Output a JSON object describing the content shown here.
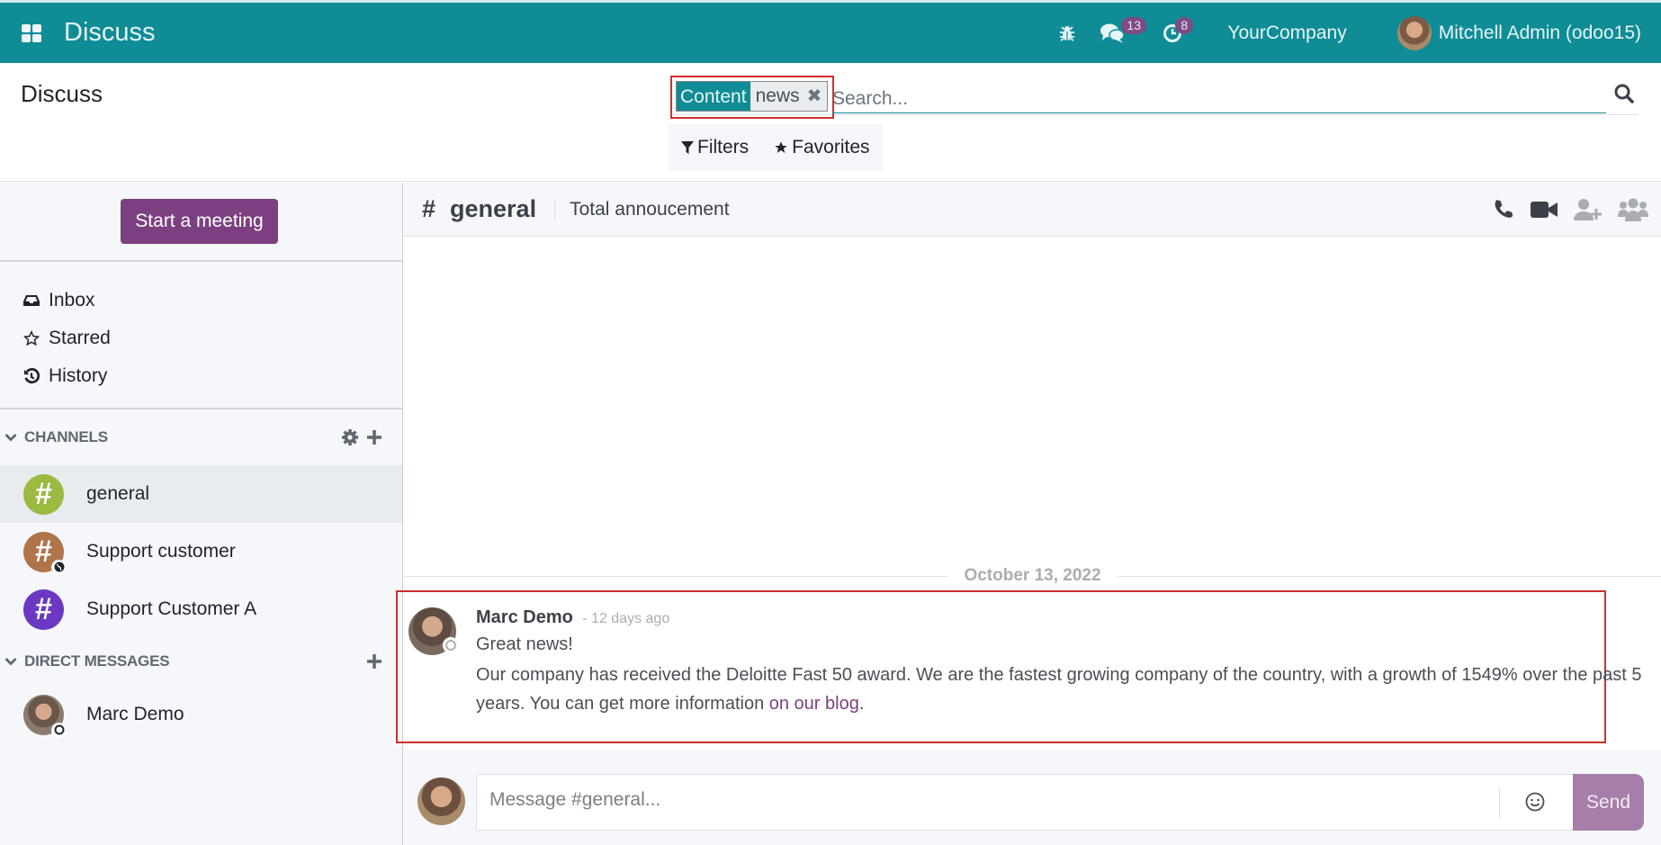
{
  "navbar": {
    "app_title": "Discuss",
    "messages_badge": "13",
    "activities_badge": "8",
    "company": "YourCompany",
    "user": "Mitchell Admin (odoo15)"
  },
  "control_panel": {
    "title": "Discuss",
    "search": {
      "facet_label": "Content",
      "facet_value": "news",
      "placeholder": "Search..."
    },
    "filters_label": "Filters",
    "favorites_label": "Favorites"
  },
  "sidebar": {
    "start_meeting": "Start a meeting",
    "mailboxes": [
      {
        "label": "Inbox",
        "icon": "inbox-icon"
      },
      {
        "label": "Starred",
        "icon": "star-icon"
      },
      {
        "label": "History",
        "icon": "history-icon"
      }
    ],
    "channels_header": "CHANNELS",
    "channels": [
      {
        "name": "general",
        "color": "#9aba42",
        "active": true
      },
      {
        "name": "Support customer",
        "color": "#b0744a",
        "public": true
      },
      {
        "name": "Support Customer A",
        "color": "#6a38c2"
      }
    ],
    "dm_header": "DIRECT MESSAGES",
    "direct_messages": [
      {
        "name": "Marc Demo"
      }
    ]
  },
  "thread": {
    "hash": "#",
    "name": "general",
    "description": "Total annoucement",
    "date_separator": "October 13, 2022",
    "message": {
      "author": "Marc Demo",
      "date": "- 12 days ago",
      "line1": "Great news!",
      "line2": "Our company has received the Deloitte Fast 50 award. We are the fastest growing company of the country, with a growth of 1549% over the past 5 years. You can get more information ",
      "link": "on our blog",
      "line_end": "."
    },
    "composer": {
      "placeholder": "Message #general...",
      "send": "Send"
    }
  },
  "colors": {
    "navbar": "#0f8c96",
    "primary": "#7c4080",
    "highlight_outline": "#cc2f2f"
  }
}
